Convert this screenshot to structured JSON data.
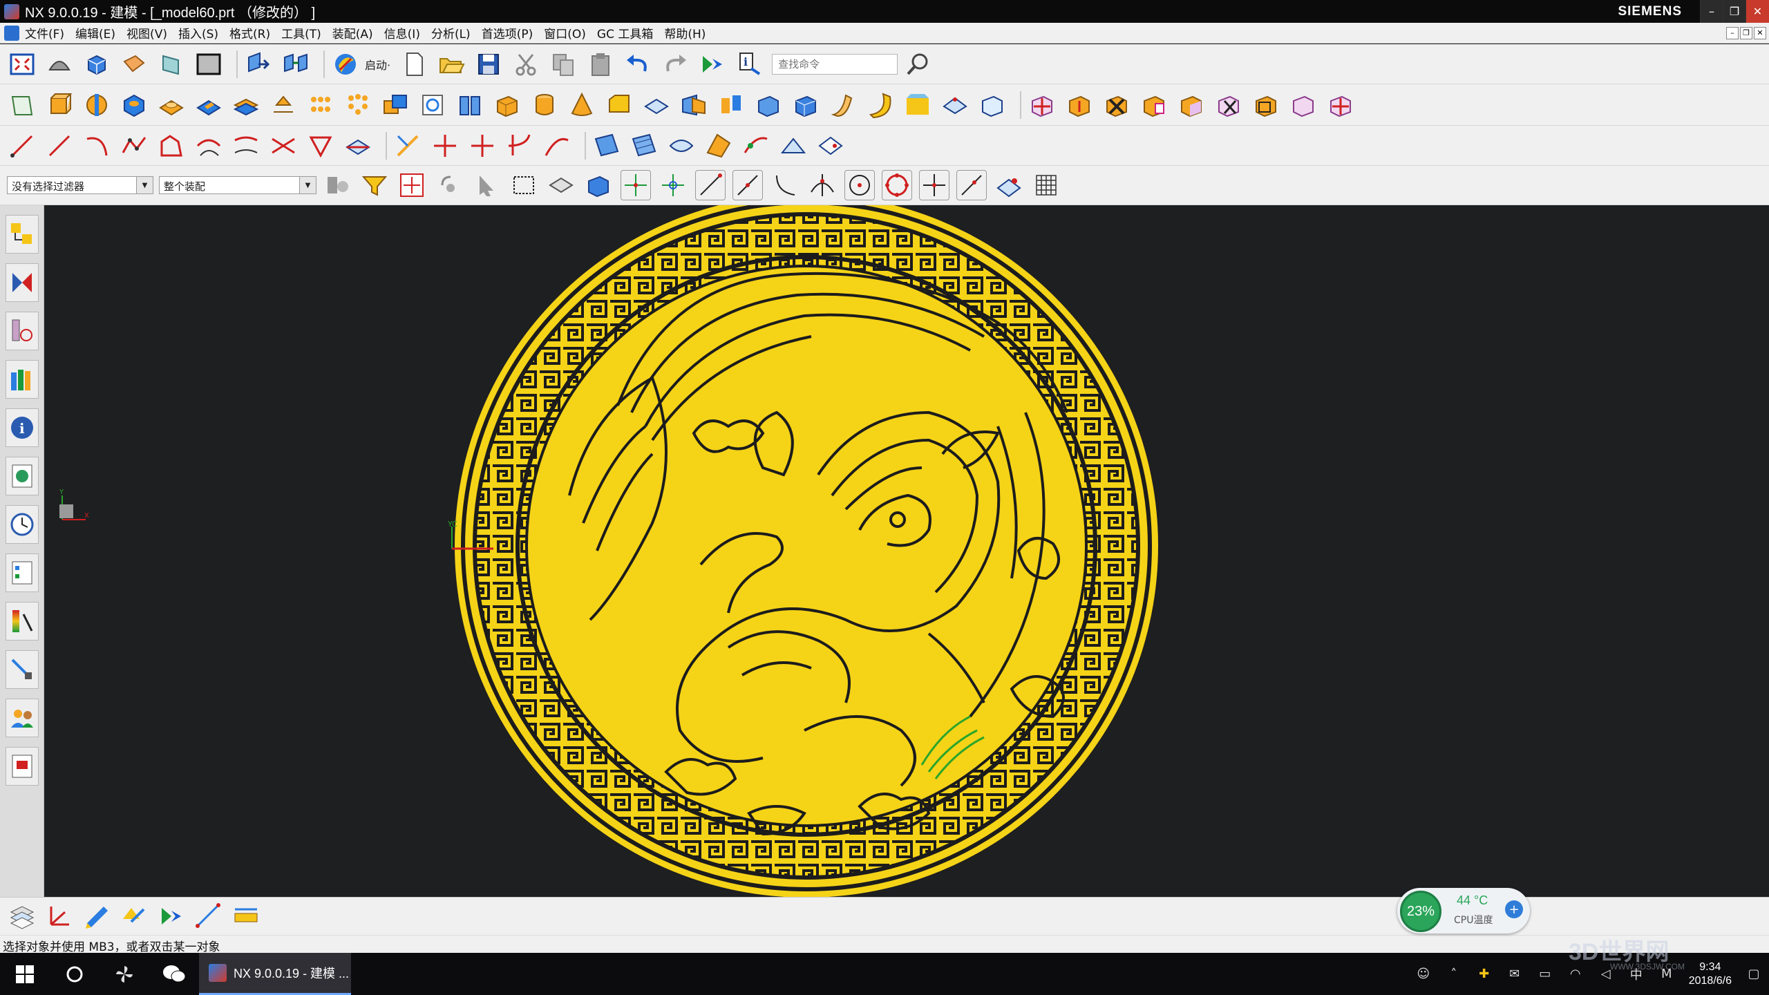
{
  "window": {
    "title": "NX 9.0.0.19 - 建模 - [_model60.prt （修改的） ]",
    "brand": "SIEMENS",
    "buttons": {
      "minimize": "–",
      "restore": "❐",
      "close": "✕"
    }
  },
  "menu": {
    "items": [
      "文件(F)",
      "编辑(E)",
      "视图(V)",
      "插入(S)",
      "格式(R)",
      "工具(T)",
      "装配(A)",
      "信息(I)",
      "分析(L)",
      "首选项(P)",
      "窗口(O)",
      "GC 工具箱",
      "帮助(H)"
    ]
  },
  "toolbar": {
    "launch_label": "启动·",
    "search_placeholder": "查找命令"
  },
  "selection_bar": {
    "filter_value": "没有选择过滤器",
    "scope_value": "整个装配"
  },
  "status": {
    "prompt": "选择对象并使用 MB3，或者双击某一对象"
  },
  "taskbar": {
    "active_app": "NX 9.0.0.19 - 建模 ...",
    "time": "9:34",
    "date": "2018/6/6",
    "ime": "中"
  },
  "cpu_widget": {
    "usage": "23%",
    "temperature": "44 °C",
    "label": "CPU温度"
  },
  "viewport": {
    "background": "#1e1f21",
    "medallion_color": "#f5d317",
    "ink_color": "#1c1c1c",
    "axis_label_yc": "YC"
  },
  "watermark": {
    "main": "3D世界网",
    "sub": "WWW.3DSJW.COM"
  }
}
